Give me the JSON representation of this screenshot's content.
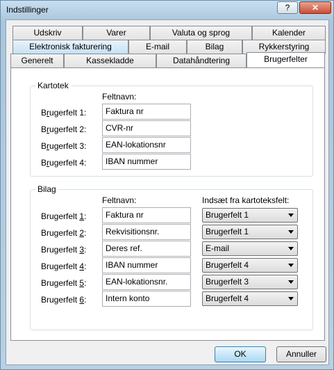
{
  "window": {
    "title": "Indstillinger",
    "help_glyph": "?",
    "close_glyph": "✕"
  },
  "tabs": {
    "row1": [
      "Udskriv",
      "Varer",
      "Valuta og sprog",
      "Kalender"
    ],
    "row2": [
      "Elektronisk fakturering",
      "E-mail",
      "Bilag",
      "Rykkerstyring"
    ],
    "row3": [
      "Generelt",
      "Kassekladde",
      "Datahåndtering",
      "Brugerfelter"
    ]
  },
  "kartotek": {
    "title": "Kartotek",
    "col_header": "Feltnavn:",
    "rows": [
      {
        "label_pre": "B",
        "label_ul": "r",
        "label_post": "ugerfelt 1:",
        "value": "Faktura nr"
      },
      {
        "label_pre": "B",
        "label_ul": "r",
        "label_post": "ugerfelt 2:",
        "value": "CVR-nr"
      },
      {
        "label_pre": "B",
        "label_ul": "r",
        "label_post": "ugerfelt 3:",
        "value": "EAN-lokationsnr"
      },
      {
        "label_pre": "B",
        "label_ul": "r",
        "label_post": "ugerfelt 4:",
        "value": "IBAN nummer"
      }
    ]
  },
  "bilag": {
    "title": "Bilag",
    "col_header": "Feltnavn:",
    "col_header2": "Indsæt fra kartoteksfelt:",
    "rows": [
      {
        "label_pre": "Brugerfelt ",
        "label_ul": "1",
        "label_post": ":",
        "value": "Faktura nr",
        "select": "Brugerfelt 1"
      },
      {
        "label_pre": "Brugerfelt ",
        "label_ul": "2",
        "label_post": ":",
        "value": "Rekvisitionsnr.",
        "select": "Brugerfelt 1"
      },
      {
        "label_pre": "Brugerfelt ",
        "label_ul": "3",
        "label_post": ":",
        "value": "Deres ref.",
        "select": "E-mail"
      },
      {
        "label_pre": "Brugerfelt ",
        "label_ul": "4",
        "label_post": ":",
        "value": "IBAN nummer",
        "select": "Brugerfelt 4"
      },
      {
        "label_pre": "Brugerfelt ",
        "label_ul": "5",
        "label_post": ":",
        "value": "EAN-lokationsnr.",
        "select": "Brugerfelt 3"
      },
      {
        "label_pre": "Brugerfelt ",
        "label_ul": "6",
        "label_post": ":",
        "value": "Intern konto",
        "select": "Brugerfelt 4"
      }
    ]
  },
  "buttons": {
    "ok": "OK",
    "cancel": "Annuller"
  }
}
